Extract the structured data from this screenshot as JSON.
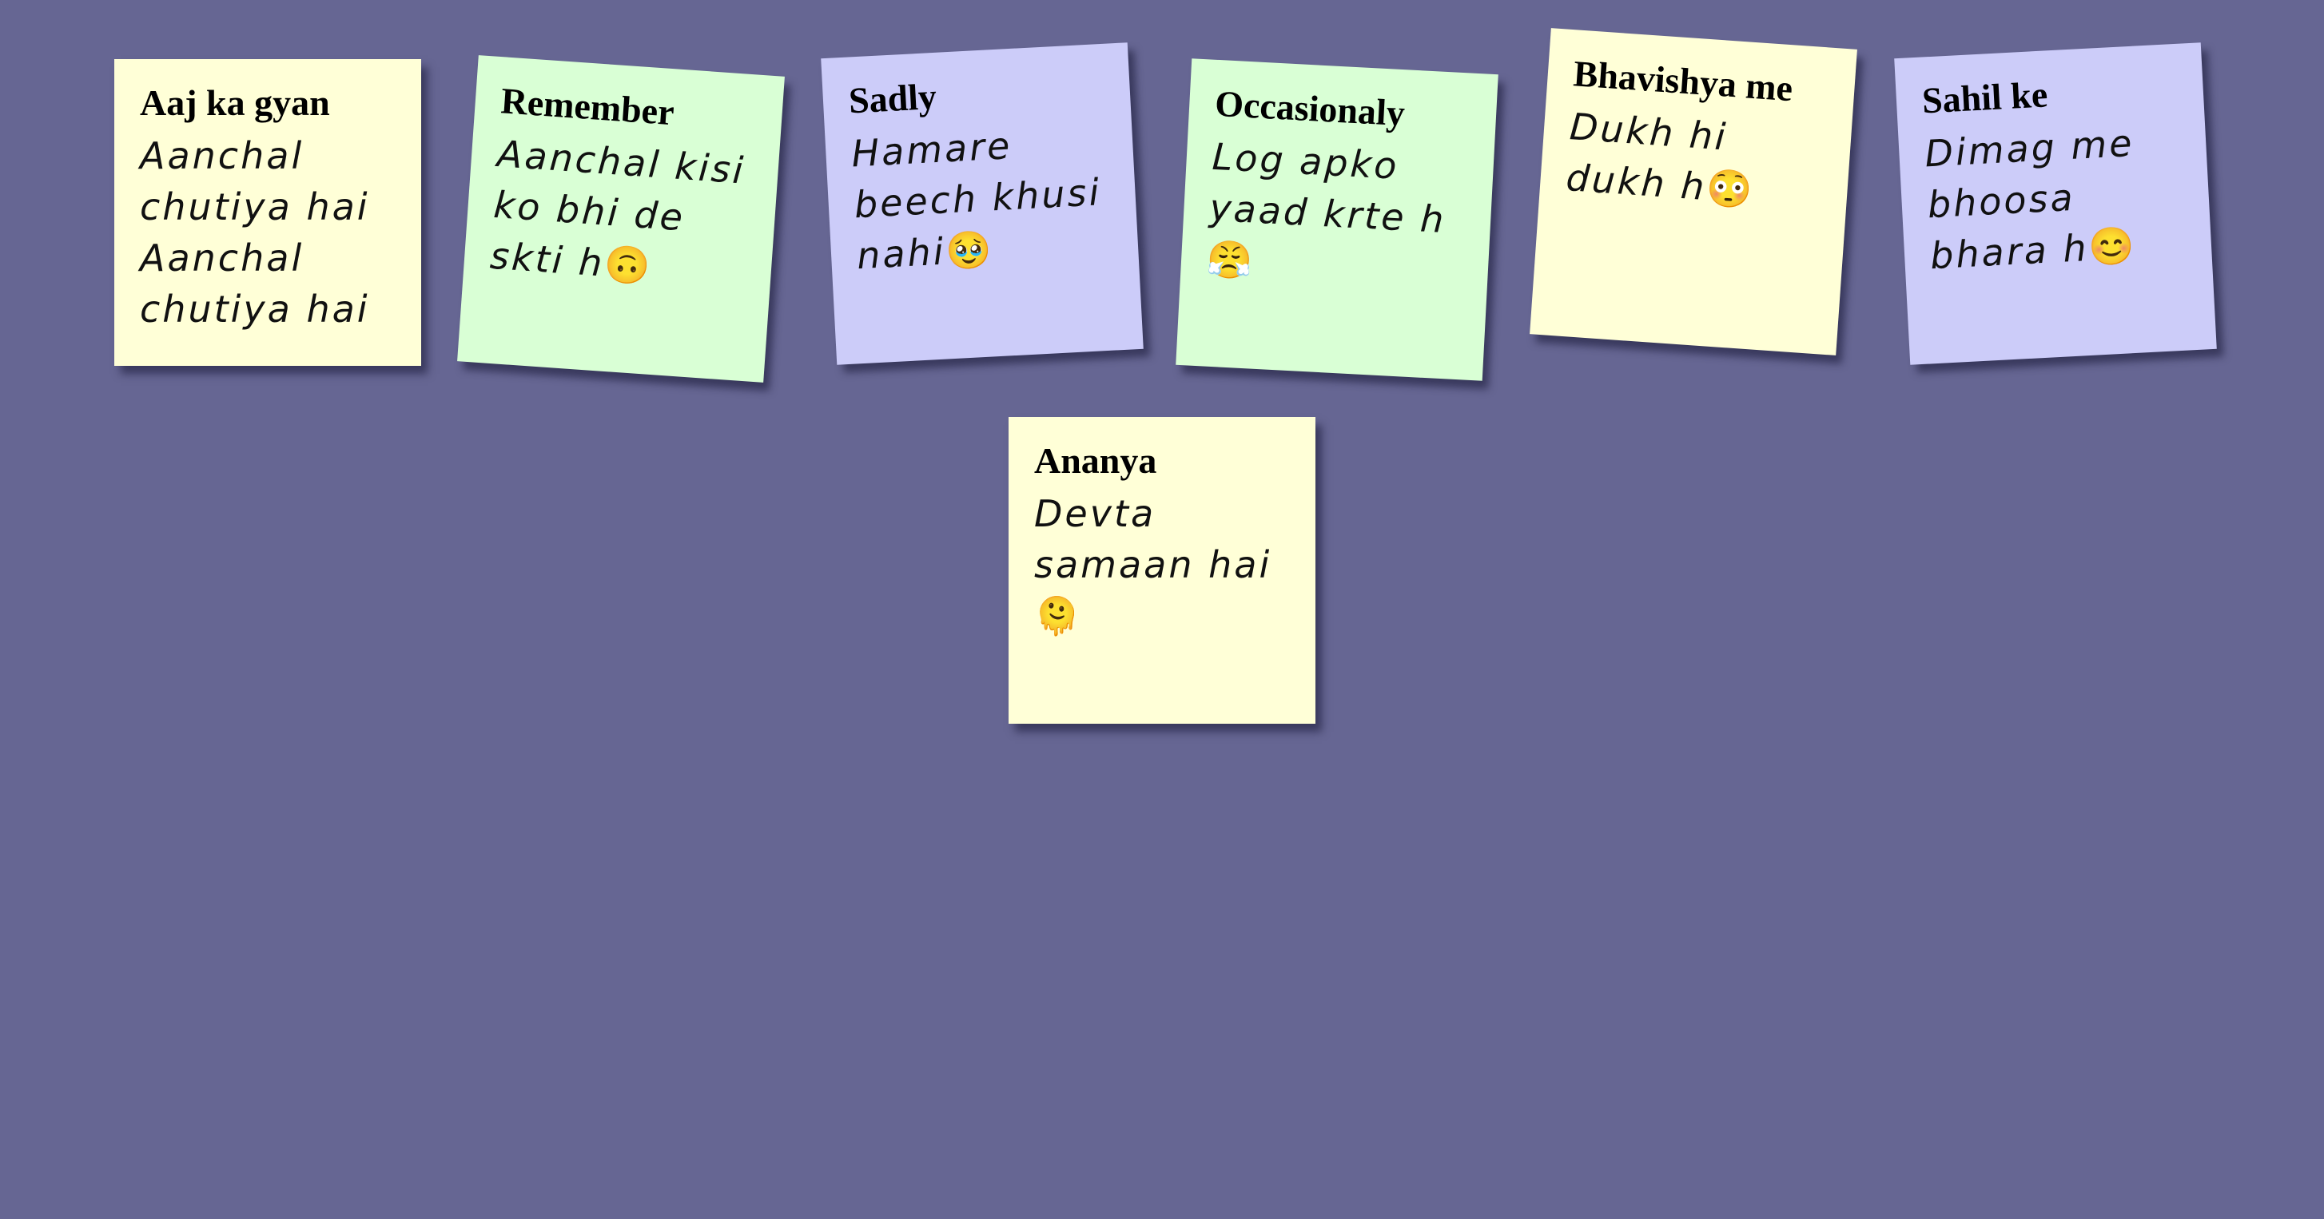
{
  "colors": {
    "board_background": "#666693",
    "note_yellow": "#ffffd7",
    "note_green": "#d9ffd5",
    "note_purple": "#ccccf9"
  },
  "notes": [
    {
      "title": "Aaj ka gyan",
      "body": "Aanchal chutiya hai Aanchal chutiya hai",
      "emoji": "",
      "color": "#ffffd7"
    },
    {
      "title": "Remember",
      "body": "Aanchal kisi ko bhi de skti h",
      "emoji": "🙃",
      "color": "#d9ffd5"
    },
    {
      "title": "Sadly",
      "body": "Hamare beech khusi nahi",
      "emoji": "🥹",
      "color": "#ccccf9"
    },
    {
      "title": "Occasionaly",
      "body": "Log apko yaad krte h",
      "emoji": "😤",
      "color": "#d9ffd5"
    },
    {
      "title": "Bhavishya me",
      "body": "Dukh hi dukh h",
      "emoji": "😳",
      "color": "#ffffd7"
    },
    {
      "title": "Sahil ke",
      "body": "Dimag me bhoosa bhara h",
      "emoji": "😊",
      "color": "#ccccf9"
    },
    {
      "title": "Ananya",
      "body": "Devta samaan hai",
      "emoji": "🫠",
      "color": "#ffffd7"
    }
  ]
}
